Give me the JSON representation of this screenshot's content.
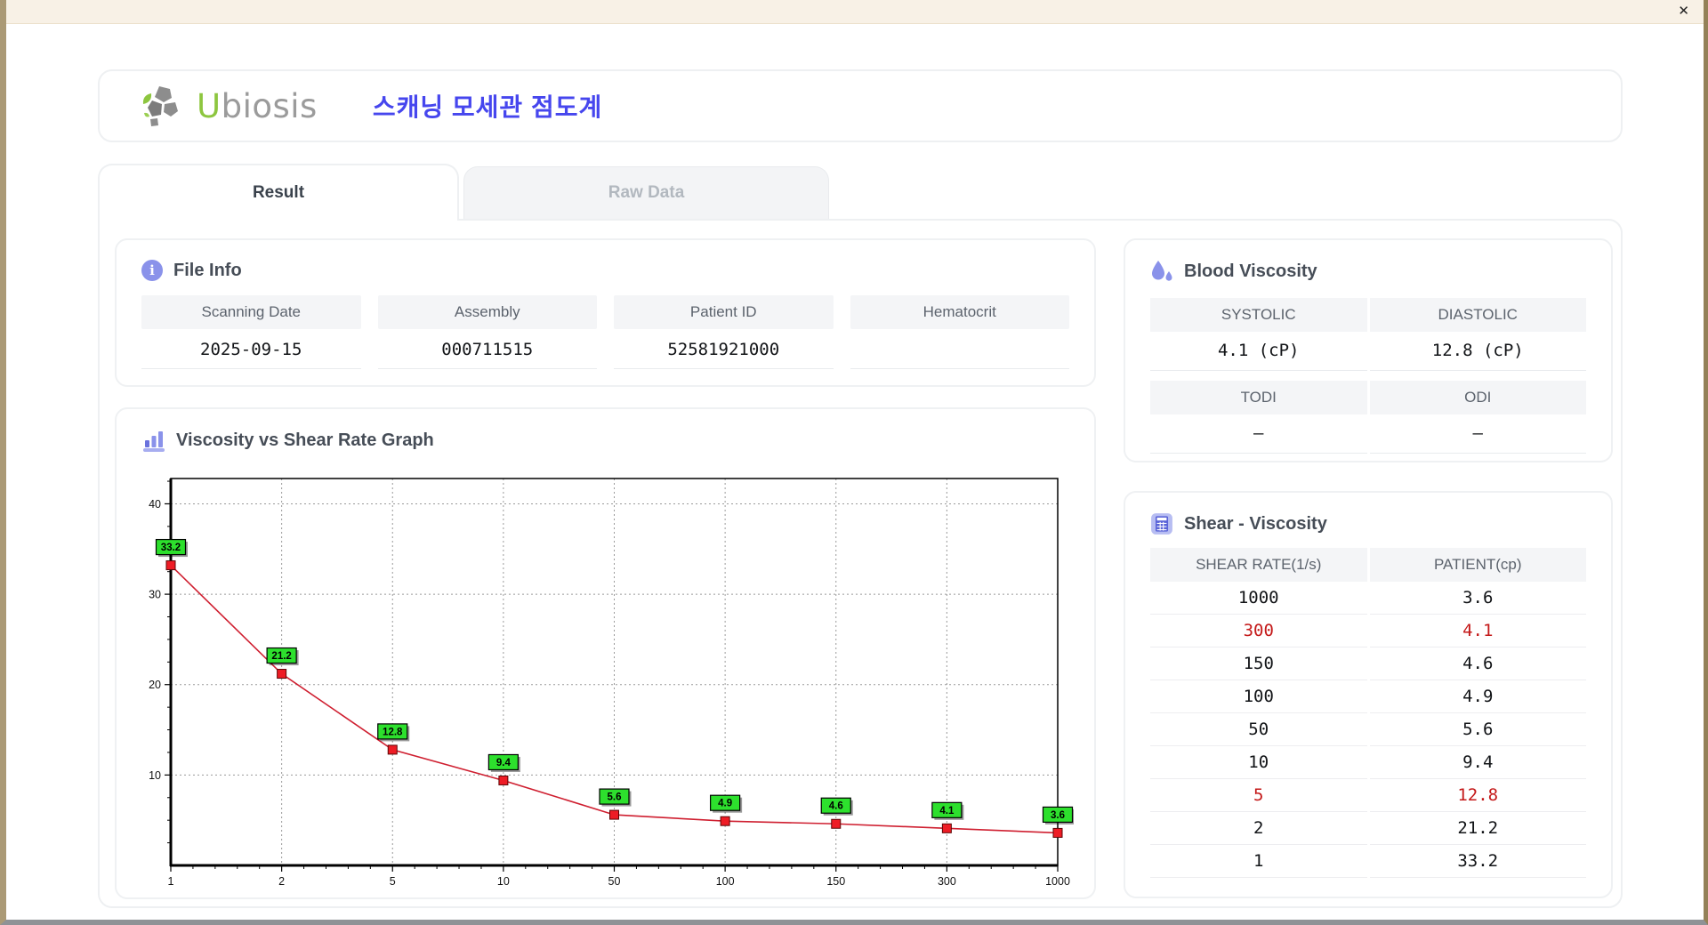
{
  "window": {
    "close_label": "✕"
  },
  "header": {
    "brand_first_letter": "U",
    "brand_rest": "biosis",
    "title": "스캐닝 모세관 점도계"
  },
  "tabs": [
    {
      "label": "Result",
      "active": true
    },
    {
      "label": "Raw Data",
      "active": false
    }
  ],
  "file_info": {
    "title": "File Info",
    "fields": [
      {
        "label": "Scanning Date",
        "value": "2025-09-15"
      },
      {
        "label": "Assembly",
        "value": "000711515"
      },
      {
        "label": "Patient ID",
        "value": "52581921000"
      },
      {
        "label": "Hematocrit",
        "value": ""
      }
    ]
  },
  "graph": {
    "title": "Viscosity vs Shear Rate Graph"
  },
  "chart_data": {
    "type": "line",
    "title": "Viscosity vs Shear Rate Graph",
    "x_scale": "categorical (log-spaced shear rates, 1/s)",
    "categories": [
      "1",
      "2",
      "5",
      "10",
      "50",
      "100",
      "150",
      "300",
      "1000"
    ],
    "values": [
      33.2,
      21.2,
      12.8,
      9.4,
      5.6,
      4.9,
      4.6,
      4.1,
      3.6
    ],
    "point_labels": [
      "33.2",
      "21.2",
      "12.8",
      "9.4",
      "5.6",
      "4.9",
      "4.6",
      "4.1",
      "3.6"
    ],
    "ylim": [
      0,
      42.8
    ],
    "yticks": [
      10,
      20,
      30,
      40
    ],
    "grid": "dashed",
    "legend": "none",
    "colors": {
      "line": "#cf1f30",
      "marker": "#ee1c25",
      "marker_edge": "#5c0606",
      "label_bg": "#2de02d",
      "label_border": "#000000",
      "grid": "#9a9a9a"
    }
  },
  "blood_viscosity": {
    "title": "Blood Viscosity",
    "cells": [
      {
        "label": "SYSTOLIC",
        "value": "4.1 (cP)"
      },
      {
        "label": "DIASTOLIC",
        "value": "12.8 (cP)"
      },
      {
        "label": "TODI",
        "value": "–"
      },
      {
        "label": "ODI",
        "value": "–"
      }
    ]
  },
  "shear_table": {
    "title": "Shear - Viscosity",
    "columns": [
      "SHEAR RATE(1/s)",
      "PATIENT(cp)"
    ],
    "rows": [
      {
        "rate": "1000",
        "value": "3.6",
        "alert": false
      },
      {
        "rate": "300",
        "value": "4.1",
        "alert": true
      },
      {
        "rate": "150",
        "value": "4.6",
        "alert": false
      },
      {
        "rate": "100",
        "value": "4.9",
        "alert": false
      },
      {
        "rate": "50",
        "value": "5.6",
        "alert": false
      },
      {
        "rate": "10",
        "value": "9.4",
        "alert": false
      },
      {
        "rate": "5",
        "value": "12.8",
        "alert": true
      },
      {
        "rate": "2",
        "value": "21.2",
        "alert": false
      },
      {
        "rate": "1",
        "value": "33.2",
        "alert": false
      }
    ]
  },
  "icons": {
    "info_glyph": "i"
  },
  "colors": {
    "accent_indigo": "#8a92ea",
    "title_blue": "#4646ee",
    "brand_green": "#8dc63f",
    "alert_red": "#c41919",
    "card_border": "#eff1f3",
    "cell_header_bg": "#f4f5f7",
    "titlebar_beige": "#f8f1e6"
  }
}
